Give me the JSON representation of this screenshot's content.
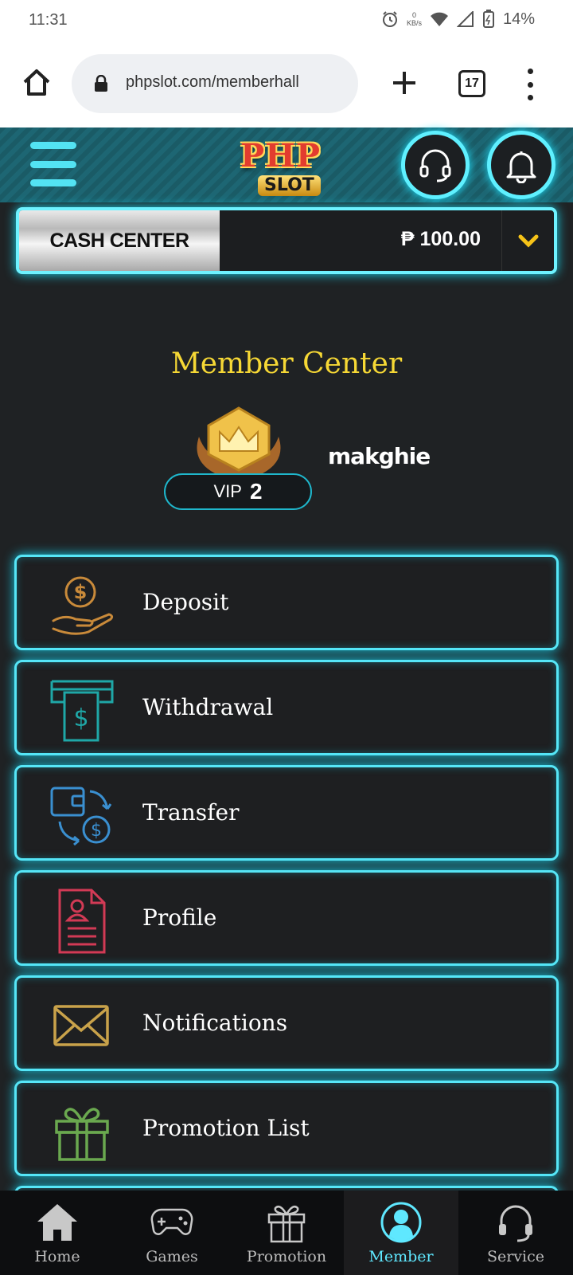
{
  "status_bar": {
    "time": "11:31",
    "net_speed_value": "0",
    "net_speed_unit": "KB/s",
    "battery": "14%"
  },
  "browser": {
    "url": "phpslot.com/memberhall",
    "tab_count": "17"
  },
  "header": {
    "logo_top": "PHP",
    "logo_bottom": "SLOT"
  },
  "cash_center": {
    "label": "CASH CENTER",
    "amount": "₱ 100.00"
  },
  "member": {
    "title": "Member Center",
    "vip_label": "VIP",
    "vip_level": "2",
    "username": "makghie"
  },
  "menu": [
    {
      "label": "Deposit",
      "icon": "deposit-icon",
      "color": "#c98a3a"
    },
    {
      "label": "Withdrawal",
      "icon": "atm-withdrawal-icon",
      "color": "#1fa7a7"
    },
    {
      "label": "Transfer",
      "icon": "wallet-transfer-icon",
      "color": "#3a8fd0"
    },
    {
      "label": "Profile",
      "icon": "profile-document-icon",
      "color": "#d23a55"
    },
    {
      "label": "Notifications",
      "icon": "envelope-icon",
      "color": "#c9a24a"
    },
    {
      "label": "Promotion List",
      "icon": "gift-icon",
      "color": "#6aa84f"
    }
  ],
  "bottom_nav": [
    {
      "label": "Home",
      "icon": "home-icon"
    },
    {
      "label": "Games",
      "icon": "gamepad-icon"
    },
    {
      "label": "Promotion",
      "icon": "gift-icon"
    },
    {
      "label": "Member",
      "icon": "member-icon",
      "active": true
    },
    {
      "label": "Service",
      "icon": "headset-icon"
    }
  ],
  "colors": {
    "accent_cyan": "#56e6f7",
    "title_yellow": "#f6d835",
    "background": "#1f2224"
  }
}
